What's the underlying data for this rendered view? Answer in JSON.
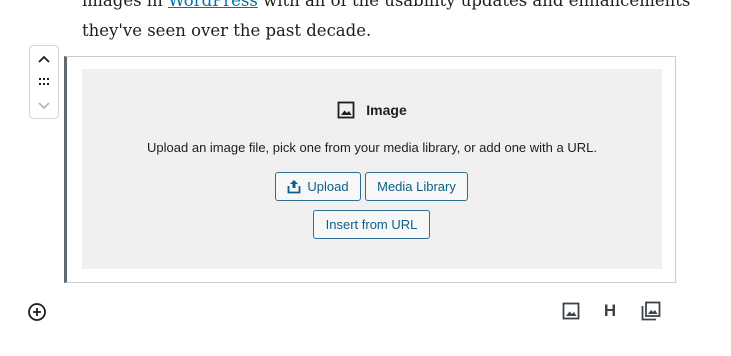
{
  "paragraph": {
    "line1_before": "images in ",
    "line1_link": "WordPress",
    "line1_after": " with all of the usability updates and enhancements",
    "line2": "they've seen over the past decade."
  },
  "block_mover": {
    "up_icon": "chevron-up-icon",
    "drag_icon": "drag-handle-icon",
    "down_icon": "chevron-down-icon"
  },
  "image_block": {
    "icon": "image-icon",
    "title": "Image",
    "instructions": "Upload an image file, pick one from your media library, or add one with a URL.",
    "upload_label": "Upload",
    "upload_icon": "upload-icon",
    "media_library_label": "Media Library",
    "insert_url_label": "Insert from URL"
  },
  "inserter": {
    "icon": "add-block-icon"
  },
  "quick_tools": [
    {
      "icon": "image-icon"
    },
    {
      "label": "H"
    },
    {
      "icon": "gallery-icon"
    }
  ],
  "colors": {
    "accent": "#0073aa",
    "button_border": "#2d6e92",
    "placeholder_bg": "#f0f0f0",
    "block_border_left": "#606a73"
  }
}
